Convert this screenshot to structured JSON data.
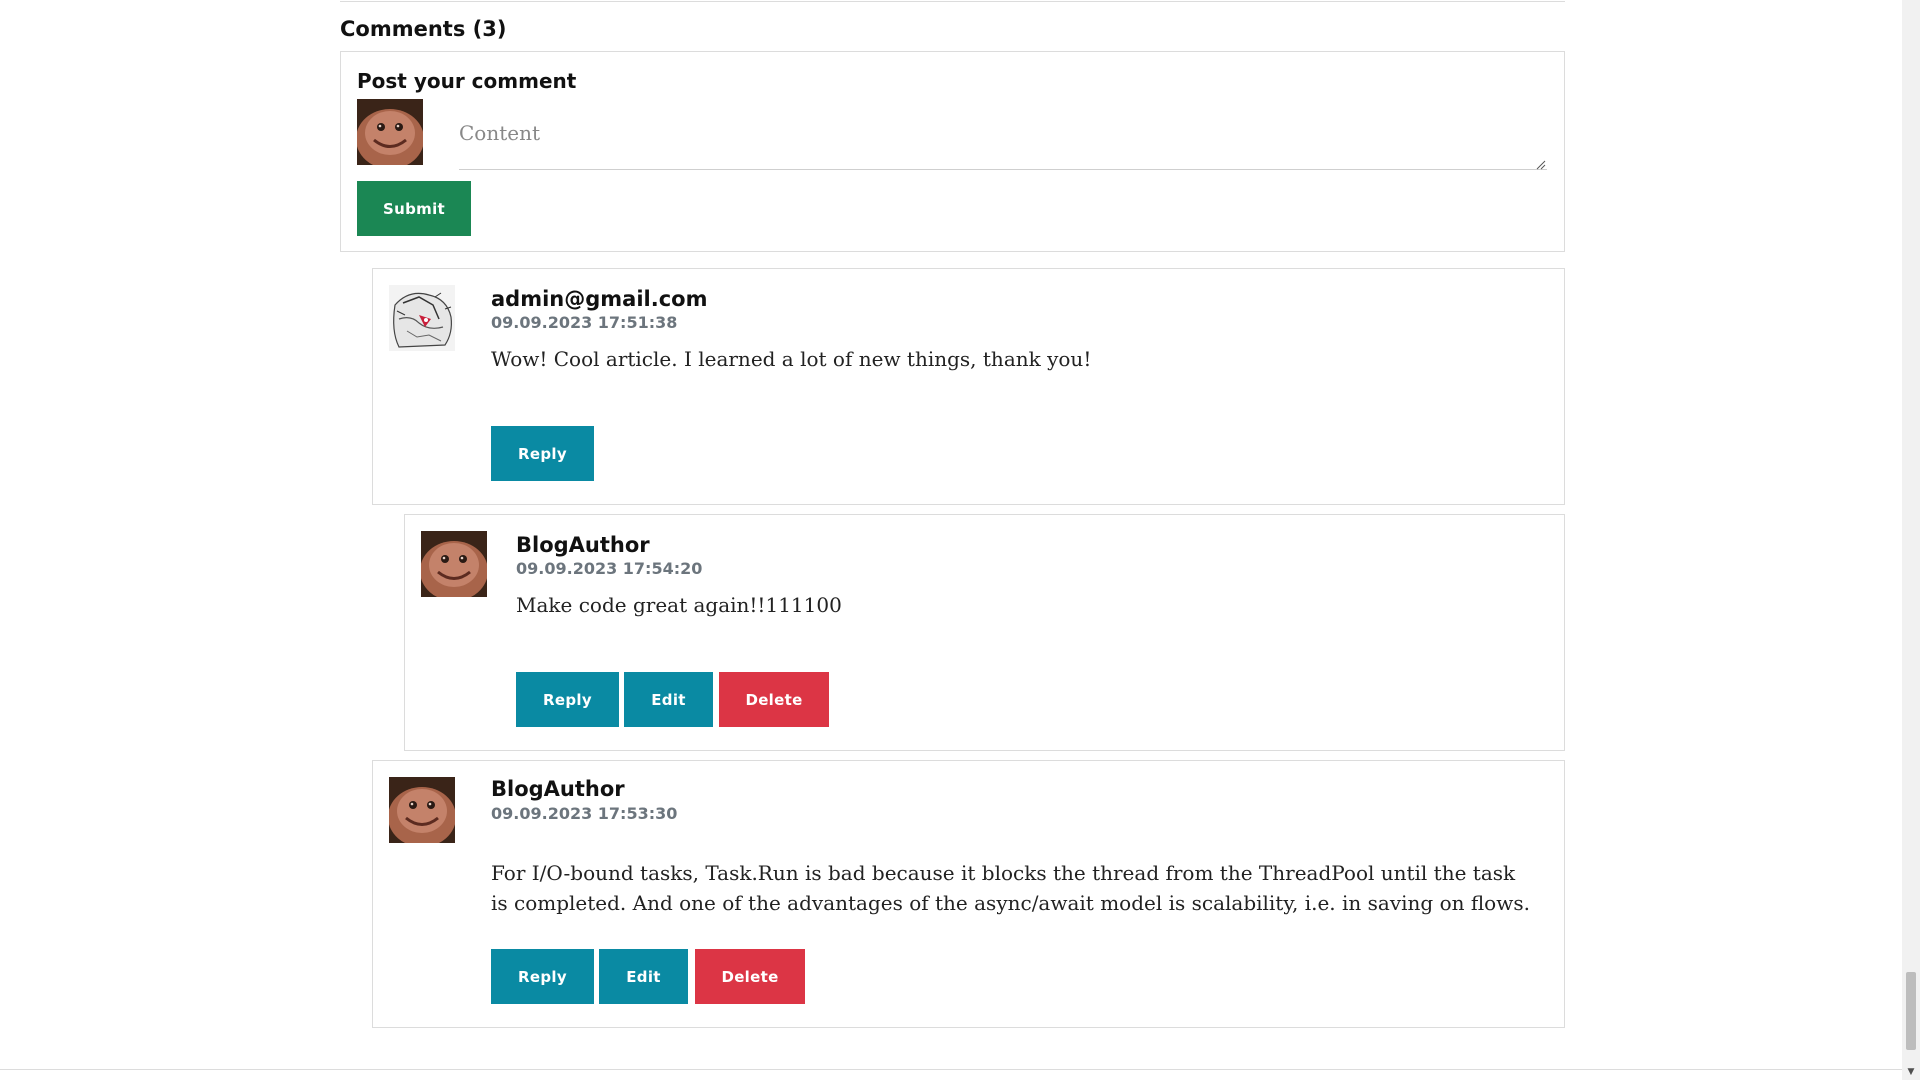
{
  "comments_section": {
    "title": "Comments (3)"
  },
  "post_form": {
    "title": "Post your comment",
    "content_placeholder": "Content",
    "submit_label": "Submit"
  },
  "comments": [
    {
      "author": "admin@gmail.com",
      "date": "09.09.2023 17:51:38",
      "text": "Wow! Cool article. I learned a lot of new things, thank you!",
      "avatar": "sketch-avatar",
      "actions": [
        "Reply"
      ]
    },
    {
      "author": "BlogAuthor",
      "date": "09.09.2023 17:54:20",
      "text": "Make code great again!!111100",
      "avatar": "smiling-face-avatar",
      "actions": [
        "Reply",
        "Edit",
        "Delete"
      ]
    },
    {
      "author": "BlogAuthor",
      "date": "09.09.2023 17:53:30",
      "text": "For I/O-bound tasks, Task.Run is bad because it blocks the thread from the ThreadPool until the task is completed. And one of the advantages of the async/await model is scalability, i.e. in saving on flows.",
      "avatar": "smiling-face-avatar",
      "actions": [
        "Reply",
        "Edit",
        "Delete"
      ]
    }
  ],
  "colors": {
    "action_teal": "#0a8aa3",
    "delete_red": "#dc3545",
    "submit_green": "#1b8754",
    "date_gray": "#6c757d",
    "border_gray": "#dcdcdc"
  }
}
